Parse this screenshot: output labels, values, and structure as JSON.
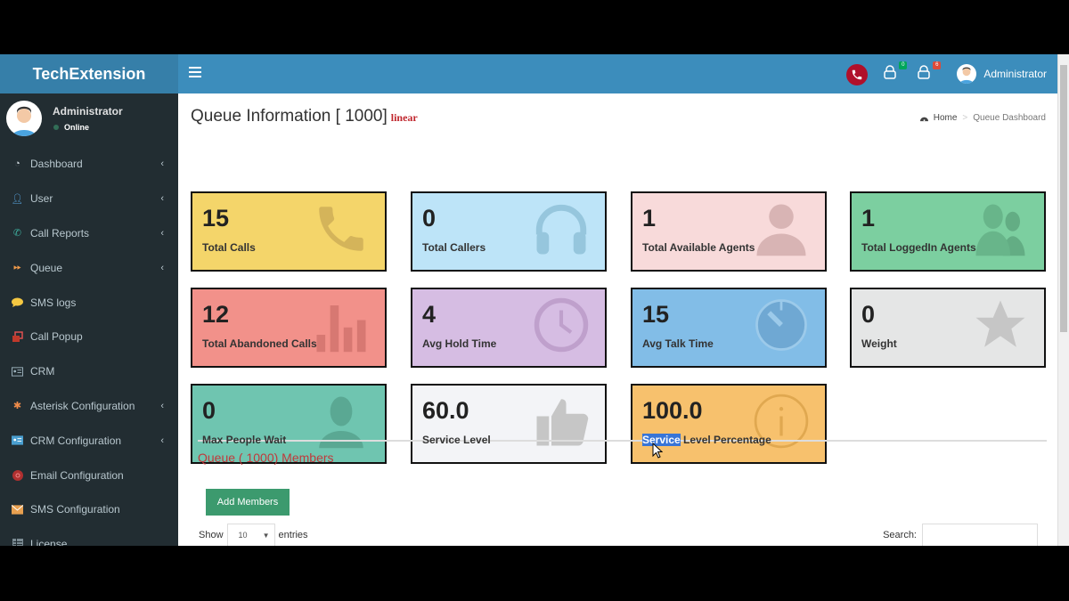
{
  "app": {
    "brand": "TechExtension"
  },
  "header": {
    "menu_toggle_icon": "hamburger-icon",
    "notifications": [
      {
        "icon": "lock-icon",
        "badge": "0",
        "badge_color": "#00a65a"
      },
      {
        "icon": "lock-icon",
        "badge": "6",
        "badge_color": "#dd4b39"
      }
    ],
    "phone_icon": "phone-icon",
    "user_name": "Administrator"
  },
  "sidebar": {
    "user": {
      "name": "Administrator",
      "status": "Online"
    },
    "items": [
      {
        "label": "Dashboard",
        "icon": "dashboard-icon",
        "has_submenu": true
      },
      {
        "label": "User",
        "icon": "user-icon",
        "has_submenu": true
      },
      {
        "label": "Call Reports",
        "icon": "phone-icon",
        "has_submenu": true
      },
      {
        "label": "Queue",
        "icon": "forward-icon",
        "has_submenu": true
      },
      {
        "label": "SMS logs",
        "icon": "comment-icon",
        "has_submenu": false
      },
      {
        "label": "Call Popup",
        "icon": "window-restore-icon",
        "has_submenu": false
      },
      {
        "label": "CRM",
        "icon": "id-card-icon",
        "has_submenu": false
      },
      {
        "label": "Asterisk Configuration",
        "icon": "asterisk-icon",
        "has_submenu": true
      },
      {
        "label": "CRM Configuration",
        "icon": "id-card-icon",
        "has_submenu": true
      },
      {
        "label": "Email Configuration",
        "icon": "at-icon",
        "has_submenu": false
      },
      {
        "label": "SMS Configuration",
        "icon": "envelope-icon",
        "has_submenu": false
      },
      {
        "label": "License",
        "icon": "list-icon",
        "has_submenu": false
      }
    ]
  },
  "page": {
    "title": "Queue Information [ 1000]",
    "strategy": "linear",
    "breadcrumb": {
      "home": "Home",
      "current": "Queue Dashboard"
    }
  },
  "cards": [
    {
      "value": "15",
      "label": "Total Calls",
      "icon": "phone-icon",
      "color": "#f4d56a"
    },
    {
      "value": "0",
      "label": "Total Callers",
      "icon": "headphones-icon",
      "color": "#bde4f8"
    },
    {
      "value": "1",
      "label": "Total Available Agents",
      "icon": "user-icon",
      "color": "#f8dada"
    },
    {
      "value": "1",
      "label": "Total LoggedIn Agents",
      "icon": "users-icon",
      "color": "#7ccfa0"
    },
    {
      "value": "12",
      "label": "Total Abandoned Calls",
      "icon": "bar-chart-icon",
      "color": "#f2918a"
    },
    {
      "value": "4",
      "label": "Avg Hold Time",
      "icon": "clock-icon",
      "color": "#d6bde3"
    },
    {
      "value": "15",
      "label": "Avg Talk Time",
      "icon": "timer-icon",
      "color": "#82bde7"
    },
    {
      "value": "0",
      "label": "Weight",
      "icon": "star-icon",
      "color": "#e5e6e6"
    },
    {
      "value": "0",
      "label": "Max People Wait",
      "icon": "user-icon",
      "color": "#6fc5b0"
    },
    {
      "value": "60.0",
      "label": "Service Level",
      "icon": "thumbs-up-icon",
      "color": "#f3f4f7"
    },
    {
      "value": "100.0",
      "label_selected": "Service",
      "label_rest": " Level Percentage",
      "icon": "info-icon",
      "color": "#f7c16d"
    }
  ],
  "members": {
    "title": "Queue ( 1000) Members",
    "add_button": "Add Members",
    "show_label": "Show",
    "page_length": "10",
    "entries_label": "entries",
    "search_label": "Search:",
    "search_value": ""
  }
}
